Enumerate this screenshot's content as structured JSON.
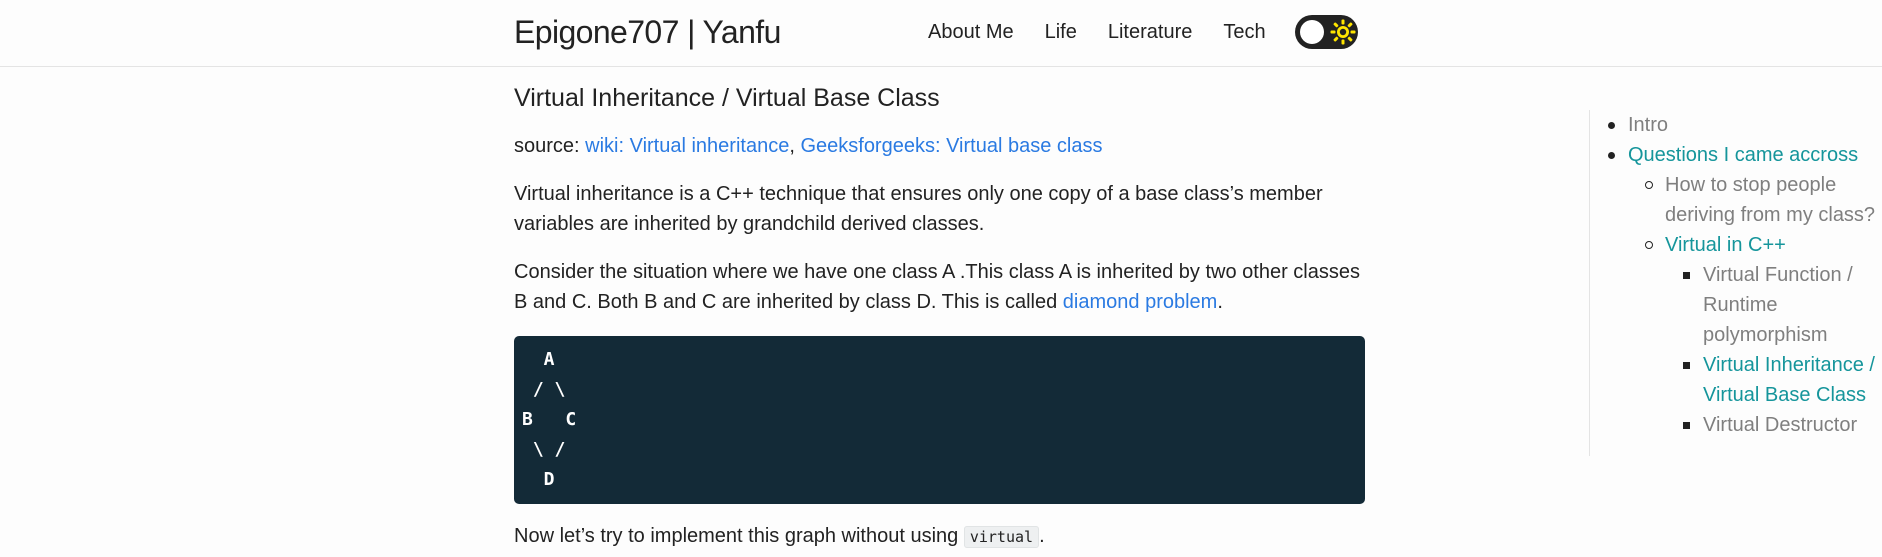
{
  "header": {
    "site_title": "Epigone707 | Yanfu",
    "nav": [
      {
        "label": "About Me"
      },
      {
        "label": "Life"
      },
      {
        "label": "Literature"
      },
      {
        "label": "Tech"
      }
    ],
    "theme_toggle_icon": "sun-icon",
    "toggle_accent": "#ffe500"
  },
  "article": {
    "title": "Virtual Inheritance / Virtual Base Class",
    "source_prefix": "source: ",
    "source_links": [
      {
        "label": "wiki: Virtual inheritance"
      },
      {
        "label": "Geeksforgeeks: Virtual base class"
      }
    ],
    "source_separator": ", ",
    "para1": "Virtual inheritance is a C++ technique that ensures only one copy of a base class’s member variables are inherited by grandchild derived classes.",
    "para2_before": "Consider the situation where we have one class A .This class A is inherited by two other classes B and C. Both B and C are inherited by class D. This is called ",
    "para2_link": "diamond problem",
    "para2_after": ".",
    "code_block": "  A\n / \\\nB   C\n \\ /\n  D",
    "para3_before": "Now let’s try to implement this graph without using ",
    "para3_code": "virtual",
    "para3_after": "."
  },
  "toc": {
    "items": [
      {
        "label": "Intro"
      },
      {
        "label": "Questions I came accross"
      },
      {
        "label": "How to stop people deriving from my class?"
      },
      {
        "label": "Virtual in C++"
      },
      {
        "label": "Virtual Function / Runtime polymorphism"
      },
      {
        "label": "Virtual Inheritance / Virtual Base Class"
      },
      {
        "label": "Virtual Destructor"
      }
    ]
  },
  "colors": {
    "link": "#2a7ae2",
    "toc_active": "#15959b",
    "toc_muted": "#7f7f7f",
    "code_bg": "#132a37"
  }
}
